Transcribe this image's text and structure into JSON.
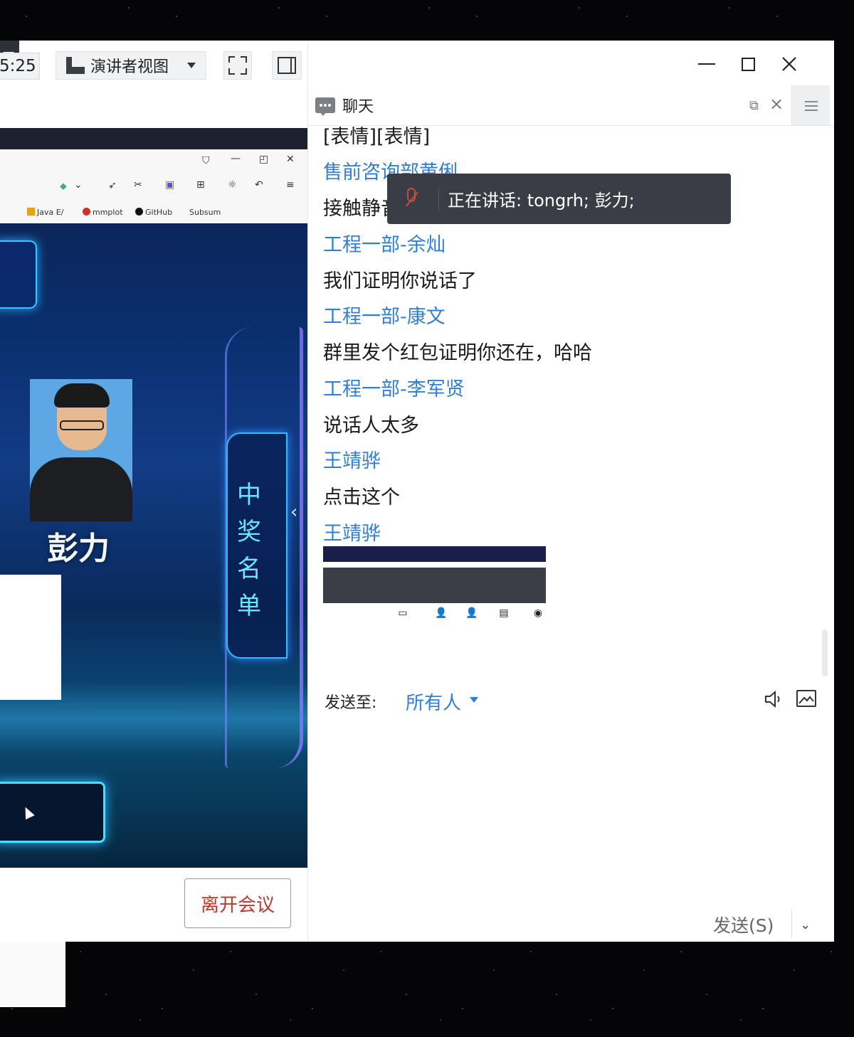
{
  "window": {
    "left_tab_glyph": "三"
  },
  "toolbar": {
    "timer": "5:25",
    "view_label": "演讲者视图"
  },
  "browser": {
    "bookmarks": [
      "Java E/",
      "mmplot",
      "GitHub",
      "Subsum"
    ]
  },
  "share": {
    "winner_name": "彭力",
    "prize_title_chars": [
      "中",
      "奖",
      "名",
      "单"
    ]
  },
  "meeting": {
    "leave_label": "离开会议"
  },
  "chat": {
    "title": "聊天",
    "messages": [
      {
        "kind": "text",
        "value": "[表情][表情]"
      },
      {
        "kind": "sender",
        "value": "售前咨询部黄俐"
      },
      {
        "kind": "text",
        "value": "接触静音"
      },
      {
        "kind": "sender",
        "value": "工程一部-余灿"
      },
      {
        "kind": "text",
        "value": "我们证明你说话了"
      },
      {
        "kind": "sender",
        "value": "工程一部-康文"
      },
      {
        "kind": "text",
        "value": "群里发个红包证明你还在，哈哈"
      },
      {
        "kind": "sender",
        "value": "工程一部-李军贤"
      },
      {
        "kind": "text",
        "value": "说话人太多"
      },
      {
        "kind": "sender",
        "value": "王靖骅"
      },
      {
        "kind": "text",
        "value": "点击这个"
      },
      {
        "kind": "sender",
        "value": "王靖骅"
      }
    ],
    "speaking_toast": "正在讲话: tongrh; 彭力;",
    "send_to_label": "发送至:",
    "recipient": "所有人",
    "send_button": "发送(S)"
  },
  "colors": {
    "sender_blue": "#2f7fd6",
    "leave_red": "#c0362c",
    "toast_bg": "#3a3d45"
  },
  "icons": [
    "minimize-icon",
    "maximize-icon",
    "close-icon",
    "presenter-view-icon",
    "fullscreen-icon",
    "layout-icon",
    "chat-icon",
    "popout-icon",
    "mic-off-icon",
    "speaker-icon",
    "image-icon"
  ]
}
